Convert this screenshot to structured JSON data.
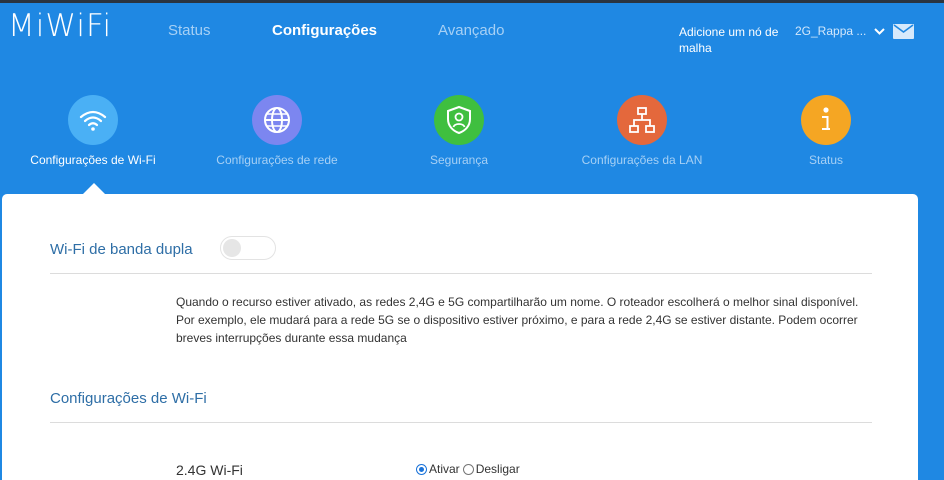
{
  "header": {
    "logo": "MiWiFi",
    "nav": [
      {
        "label": "Status"
      },
      {
        "label": "Configurações"
      },
      {
        "label": "Avançado"
      }
    ],
    "mesh_link": "Adicione um nó de malha",
    "network_name": "2G_Rappa ...",
    "icons": {
      "dropdown": "chevron-down-icon",
      "mail": "mail-icon"
    }
  },
  "categories": [
    {
      "label": "Configurações de Wi-Fi",
      "icon": "wifi-icon",
      "color": "#4ab0f5"
    },
    {
      "label": "Configurações de rede",
      "icon": "globe-icon",
      "color": "#7c86f0"
    },
    {
      "label": "Segurança",
      "icon": "shield-user-icon",
      "color": "#3fbf3f"
    },
    {
      "label": "Configurações da LAN",
      "icon": "lan-topology-icon",
      "color": "#e4683c"
    },
    {
      "label": "Status",
      "icon": "info-icon",
      "color": "#f5a623"
    }
  ],
  "content": {
    "dual_band": {
      "title": "Wi-Fi de banda dupla",
      "enabled": false,
      "description": "Quando o recurso estiver ativado, as redes 2,4G e 5G compartilharão um nome. O roteador escolherá o melhor sinal disponível. Por exemplo, ele mudará para a rede 5G se o dispositivo estiver próximo, e para a rede 2,4G se estiver distante. Podem ocorrer breves interrupções durante essa mudança"
    },
    "wifi_settings": {
      "title": "Configurações de Wi-Fi",
      "band_label": "2.4G Wi-Fi",
      "options": [
        {
          "label": "Ativar",
          "checked": true
        },
        {
          "label": "Desligar",
          "checked": false
        }
      ]
    }
  },
  "colors": {
    "header_bg": "#1f88e3",
    "accent_text": "#2e6ea6",
    "inactive_nav": "#a6d0f5"
  }
}
